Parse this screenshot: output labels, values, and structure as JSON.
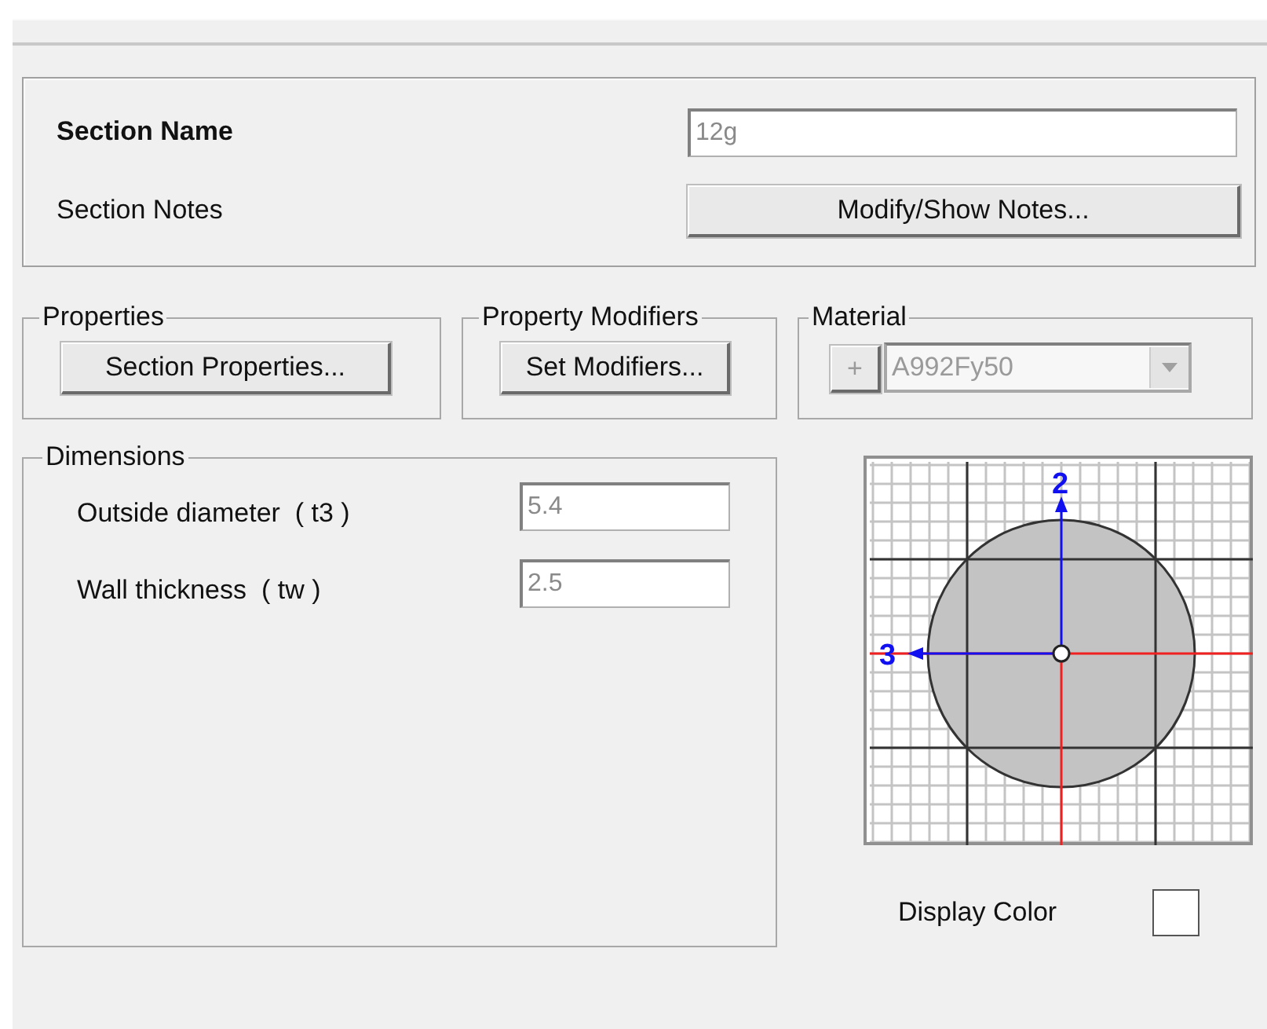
{
  "section_name": {
    "label": "Section Name",
    "value": "12g",
    "disabled": true
  },
  "section_notes": {
    "label": "Section Notes",
    "button": "Modify/Show Notes..."
  },
  "groups": [
    {
      "title": "Properties",
      "button": "Section Properties..."
    },
    {
      "title": "Property Modifiers",
      "button": "Set Modifiers..."
    }
  ],
  "material": {
    "title": "Material",
    "add_button": "+",
    "value": "A992Fy50",
    "disabled": true
  },
  "dimensions": {
    "title": "Dimensions",
    "fields": [
      {
        "label": "Outside diameter  ( t3 )",
        "value": "5.4",
        "disabled": true
      },
      {
        "label": "Wall thickness  ( tw )",
        "value": "2.5",
        "disabled": true
      }
    ]
  },
  "preview": {
    "axis_vertical": "2",
    "axis_horizontal": "3"
  },
  "display_color": {
    "label": "Display Color",
    "color": "#ffffff"
  }
}
